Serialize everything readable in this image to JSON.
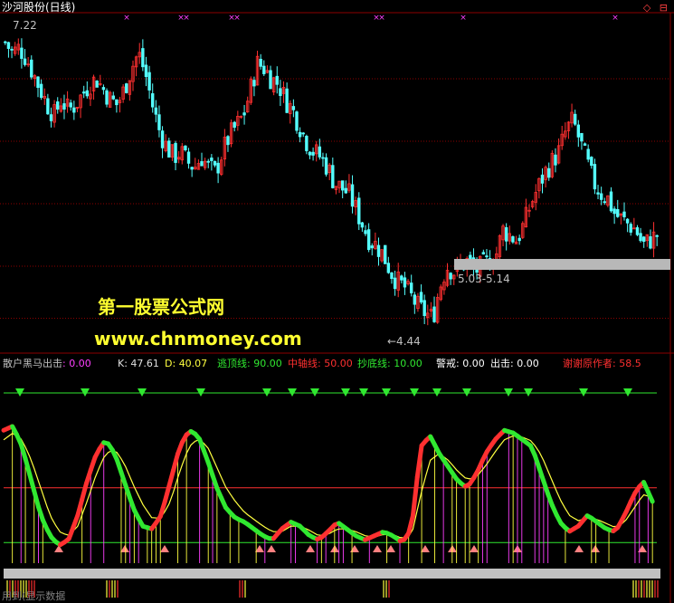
{
  "window": {
    "title": "沙河股份(日线)",
    "corner_icons": "◇ ⊟",
    "bottom_text": "用到(显示数据"
  },
  "watermark": {
    "line1": "第一股票公式网",
    "line2": "www.chnmoney.com"
  },
  "colors": {
    "bg": "#000000",
    "up": "#ff3030",
    "down": "#54ffff",
    "grid": "#8b0000",
    "magenta": "#ff40ff",
    "green": "#30e830",
    "yellow": "#ffff40",
    "gray_bar": "#c0c0c0"
  },
  "chart_data": [
    {
      "type": "candlestick",
      "title": "沙河股份(日线)",
      "ylim": [
        4.2,
        7.4
      ],
      "annotations": {
        "high": "7.22",
        "low": "←4.44",
        "range": "5.03-5.14"
      },
      "close_series": [
        7.15,
        7.05,
        7.1,
        7.0,
        6.85,
        6.7,
        6.55,
        6.45,
        6.6,
        6.5,
        6.55,
        6.65,
        6.75,
        6.8,
        6.7,
        6.6,
        6.55,
        6.7,
        6.9,
        7.05,
        6.85,
        6.55,
        6.3,
        6.15,
        6.05,
        6.1,
        6.0,
        5.95,
        6.05,
        5.95,
        5.9,
        6.1,
        6.25,
        6.35,
        6.45,
        6.7,
        6.95,
        6.9,
        6.8,
        6.75,
        6.6,
        6.5,
        6.35,
        6.2,
        6.1,
        6.05,
        5.95,
        5.8,
        5.75,
        5.7,
        5.55,
        5.4,
        5.25,
        5.2,
        5.1,
        4.95,
        4.85,
        4.8,
        4.7,
        4.6,
        4.55,
        4.5,
        4.8,
        5.0,
        4.95,
        5.0,
        5.05,
        4.95,
        5.0,
        5.05,
        5.1,
        5.35,
        5.3,
        5.25,
        5.4,
        5.6,
        5.75,
        5.9,
        6.0,
        6.1,
        6.3,
        6.4,
        6.2,
        6.0,
        5.8,
        5.7,
        5.65,
        5.5,
        5.45,
        5.4,
        5.35,
        5.2,
        5.25,
        5.3
      ]
    },
    {
      "type": "line",
      "title": "散户黑马出击",
      "legend": [
        {
          "label": "散户黑马出击",
          "value": "0.00"
        },
        {
          "label": "K",
          "value": "47.61"
        },
        {
          "label": "D",
          "value": "40.07"
        },
        {
          "label": "逃顶线",
          "value": "90.00"
        },
        {
          "label": "中轴线",
          "value": "50.00"
        },
        {
          "label": "抄底线",
          "value": "10.00"
        },
        {
          "label": "警戒",
          "value": "0.00"
        },
        {
          "label": "出击",
          "value": "0.00"
        },
        {
          "label": "谢谢原作者",
          "value": "58.5"
        }
      ],
      "levels": {
        "escape_top": 90,
        "mid_axis": 50,
        "bottom": 10
      },
      "ylim": [
        -5,
        110
      ],
      "k_series": [
        92,
        95,
        80,
        55,
        30,
        15,
        8,
        12,
        30,
        55,
        75,
        85,
        75,
        55,
        35,
        22,
        20,
        30,
        55,
        80,
        92,
        88,
        70,
        50,
        35,
        28,
        25,
        20,
        15,
        12,
        20,
        25,
        22,
        15,
        12,
        18,
        25,
        20,
        15,
        12,
        15,
        18,
        15,
        10,
        20,
        80,
        88,
        75,
        65,
        55,
        50,
        60,
        75,
        85,
        92,
        90,
        85,
        80,
        60,
        40,
        25,
        18,
        22,
        30,
        25,
        20,
        18,
        30,
        45,
        55,
        40
      ],
      "d_series": [
        85,
        90,
        85,
        70,
        50,
        30,
        18,
        15,
        22,
        40,
        60,
        75,
        78,
        68,
        52,
        38,
        28,
        28,
        40,
        62,
        80,
        86,
        80,
        65,
        50,
        40,
        32,
        27,
        22,
        18,
        18,
        22,
        22,
        19,
        15,
        16,
        20,
        20,
        18,
        15,
        14,
        16,
        16,
        13,
        15,
        45,
        70,
        75,
        70,
        62,
        56,
        58,
        66,
        76,
        85,
        88,
        87,
        84,
        74,
        58,
        42,
        30,
        26,
        28,
        27,
        24,
        21,
        25,
        35,
        45,
        43
      ]
    }
  ]
}
